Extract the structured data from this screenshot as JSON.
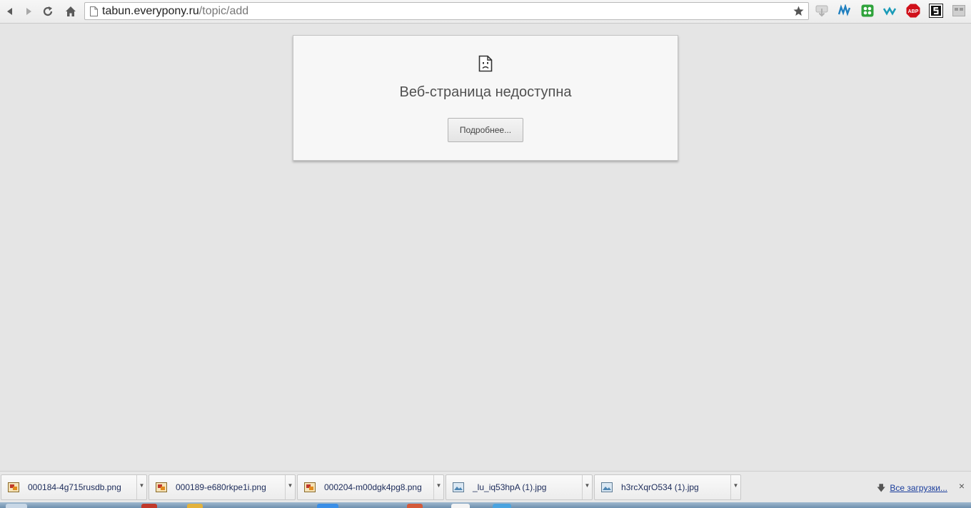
{
  "browser": {
    "url_domain": "tabun.everypony.ru",
    "url_path": "/topic/add",
    "toolbar_icons": [
      "back-icon",
      "forward-icon",
      "reload-icon",
      "home-icon",
      "page-icon",
      "bookmark-star-icon"
    ],
    "extensions": [
      "download-ext-icon",
      "stats-ext-icon",
      "green-ext-icon",
      "wave-ext-icon",
      "adblock-ext-icon",
      "s-ext-icon",
      "menu-ext-icon"
    ],
    "adblock_label": "ABP"
  },
  "error_card": {
    "title": "Веб-страница недоступна",
    "details_button": "Подробнее..."
  },
  "download_shelf": {
    "items": [
      {
        "name": "000184-4g715rusdb.png",
        "icon": "png-file-icon"
      },
      {
        "name": "000189-e680rkpe1i.png",
        "icon": "png-file-icon"
      },
      {
        "name": "000204-m00dgk4pg8.png",
        "icon": "png-file-icon"
      },
      {
        "name": "_lu_iq53hpA (1).jpg",
        "icon": "jpg-file-icon"
      },
      {
        "name": "h3rcXqrO534 (1).jpg",
        "icon": "jpg-file-icon"
      }
    ],
    "all_downloads": "Все загрузки...",
    "close_glyph": "×"
  },
  "colors": {
    "page_bg": "#e5e5e5",
    "card_bg": "#f7f7f7",
    "link": "#1a3d9c",
    "adblock_red": "#d0101a"
  }
}
